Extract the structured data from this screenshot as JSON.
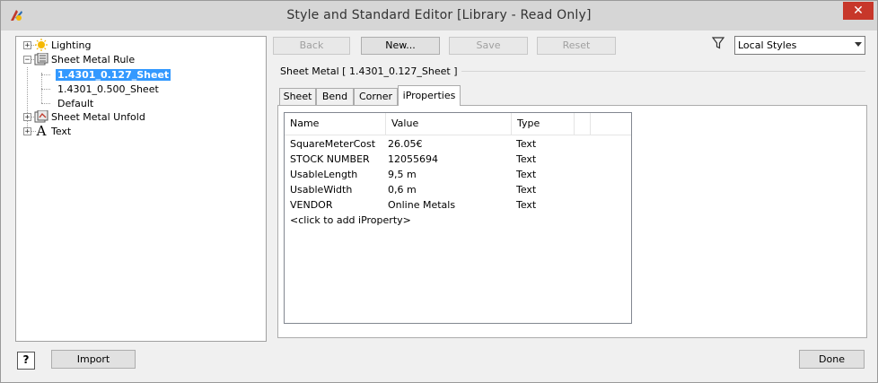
{
  "window": {
    "title": "Style and Standard Editor [Library - Read Only]",
    "close_label": "✕"
  },
  "tree": {
    "items": [
      {
        "label": "Lighting",
        "expander": "+"
      },
      {
        "label": "Sheet Metal Rule",
        "expander": "−"
      },
      {
        "label": "1.4301_0.127_Sheet",
        "selected": true
      },
      {
        "label": "1.4301_0.500_Sheet"
      },
      {
        "label": "Default"
      },
      {
        "label": "Sheet Metal Unfold",
        "expander": "+"
      },
      {
        "label": "Text",
        "expander": "+",
        "icon_text": "A"
      }
    ]
  },
  "toolbar": {
    "back_label": "Back",
    "new_label": "New...",
    "save_label": "Save",
    "reset_label": "Reset"
  },
  "filter": {
    "selected": "Local Styles"
  },
  "group": {
    "title": "Sheet Metal [ 1.4301_0.127_Sheet ]"
  },
  "tabs": [
    {
      "label": "Sheet"
    },
    {
      "label": "Bend"
    },
    {
      "label": "Corner"
    },
    {
      "label": "iProperties",
      "active": true
    }
  ],
  "iproperties": {
    "columns": [
      "Name",
      "Value",
      "Type"
    ],
    "rows": [
      {
        "name": "SquareMeterCost",
        "value": "26.05€",
        "type": "Text"
      },
      {
        "name": "STOCK NUMBER",
        "value": "12055694",
        "type": "Text"
      },
      {
        "name": "UsableLength",
        "value": "9,5 m",
        "type": "Text"
      },
      {
        "name": "UsableWidth",
        "value": "0,6 m",
        "type": "Text"
      },
      {
        "name": "VENDOR",
        "value": "Online Metals",
        "type": "Text"
      }
    ],
    "add_row_label": "<click to add iProperty>"
  },
  "footer": {
    "help_label": "?",
    "import_label": "Import",
    "done_label": "Done"
  },
  "colors": {
    "selection": "#3399ff",
    "close": "#c7372a",
    "lighting_icon": "#f5b800"
  }
}
